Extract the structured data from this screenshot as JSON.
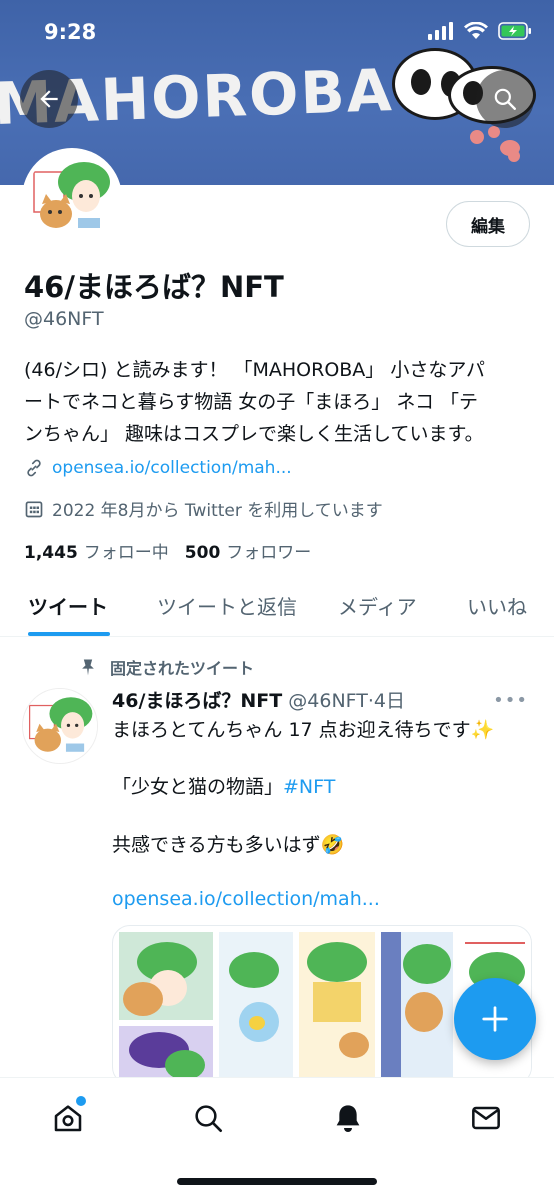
{
  "status_bar": {
    "time": "9:28"
  },
  "banner": {
    "text": "MAHOROBA ?"
  },
  "profile": {
    "edit_label": "編集",
    "name": "46/まほろば？NFT",
    "handle": "@46NFT",
    "bio_lines": [
      "(46/シロ) と読みます！ 「MAHOROBA」 小さなアパ",
      "ートでネコと暮らす物語 女の子「まほろ」 ネコ 「テ",
      "ンちゃん」 趣味はコスプレで楽しく生活しています。"
    ],
    "link": "opensea.io/collection/mah...",
    "joined": "2022 年8月から Twitter を利用しています",
    "following_count": "1,445",
    "following_label": "フォロー中",
    "followers_count": "500",
    "followers_label": "フォロワー"
  },
  "tabs": [
    {
      "label": "ツイート",
      "active": true
    },
    {
      "label": "ツイートと返信",
      "active": false
    },
    {
      "label": "メディア",
      "active": false
    },
    {
      "label": "いいね",
      "active": false
    }
  ],
  "tweet": {
    "pinned_label": "固定されたツイート",
    "author_name": "46/まほろば？NFT",
    "author_handle": "@46NFT",
    "time": "·4日",
    "more": "•••",
    "line1": "まほろとてんちゃん 17 点お迎え待ちです✨",
    "line2_prefix": "「少女と猫の物語」",
    "line2_hashtag": "#NFT",
    "line3": "共感できる方も多いはず🤣",
    "link": "opensea.io/collection/mah..."
  },
  "icons": {
    "back": "arrow-left-icon",
    "search": "search-icon",
    "link": "link-icon",
    "calendar": "calendar-icon",
    "pin": "pin-icon",
    "compose": "plus-icon",
    "nav": [
      "home-icon",
      "search-icon",
      "bell-icon",
      "mail-icon"
    ]
  },
  "colors": {
    "accent": "#1d9bf0",
    "banner": "#4a6fb5",
    "text_secondary": "#536471"
  }
}
